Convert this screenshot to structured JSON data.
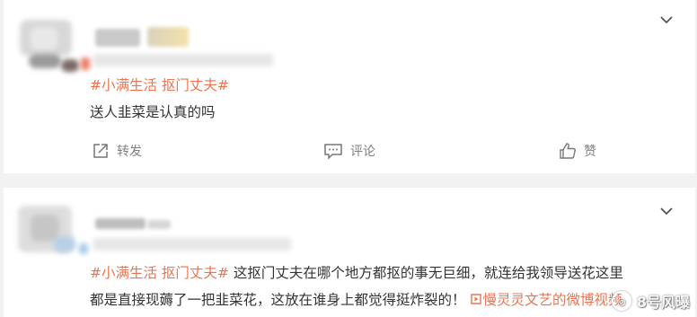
{
  "colors": {
    "accent": "#eb7350",
    "text": "#333333",
    "muted": "#808080",
    "background": "#f2f2f2",
    "card": "#ffffff"
  },
  "post1": {
    "hashtag": "#小满生活 抠门丈夫#",
    "text": "送人韭菜是认真的吗",
    "actions": {
      "repost": "转发",
      "comment": "评论",
      "like": "赞"
    },
    "icons": [
      "chevron-down-icon",
      "share-icon",
      "comment-icon",
      "thumbs-up-icon"
    ]
  },
  "post2": {
    "hashtag": "#小满生活 抠门丈夫#",
    "text_line1": " 这抠门丈夫在哪个地方都抠的事无巨细，就连给我领导送花这里",
    "text_line2": "都是直接现薅了一把韭菜花，这放在谁身上都觉得挺炸裂的！",
    "video_link": "慢灵灵文艺的微博视频",
    "icons": [
      "chevron-down-icon",
      "video-link-icon"
    ]
  },
  "watermark": {
    "text": "8号风曝"
  }
}
